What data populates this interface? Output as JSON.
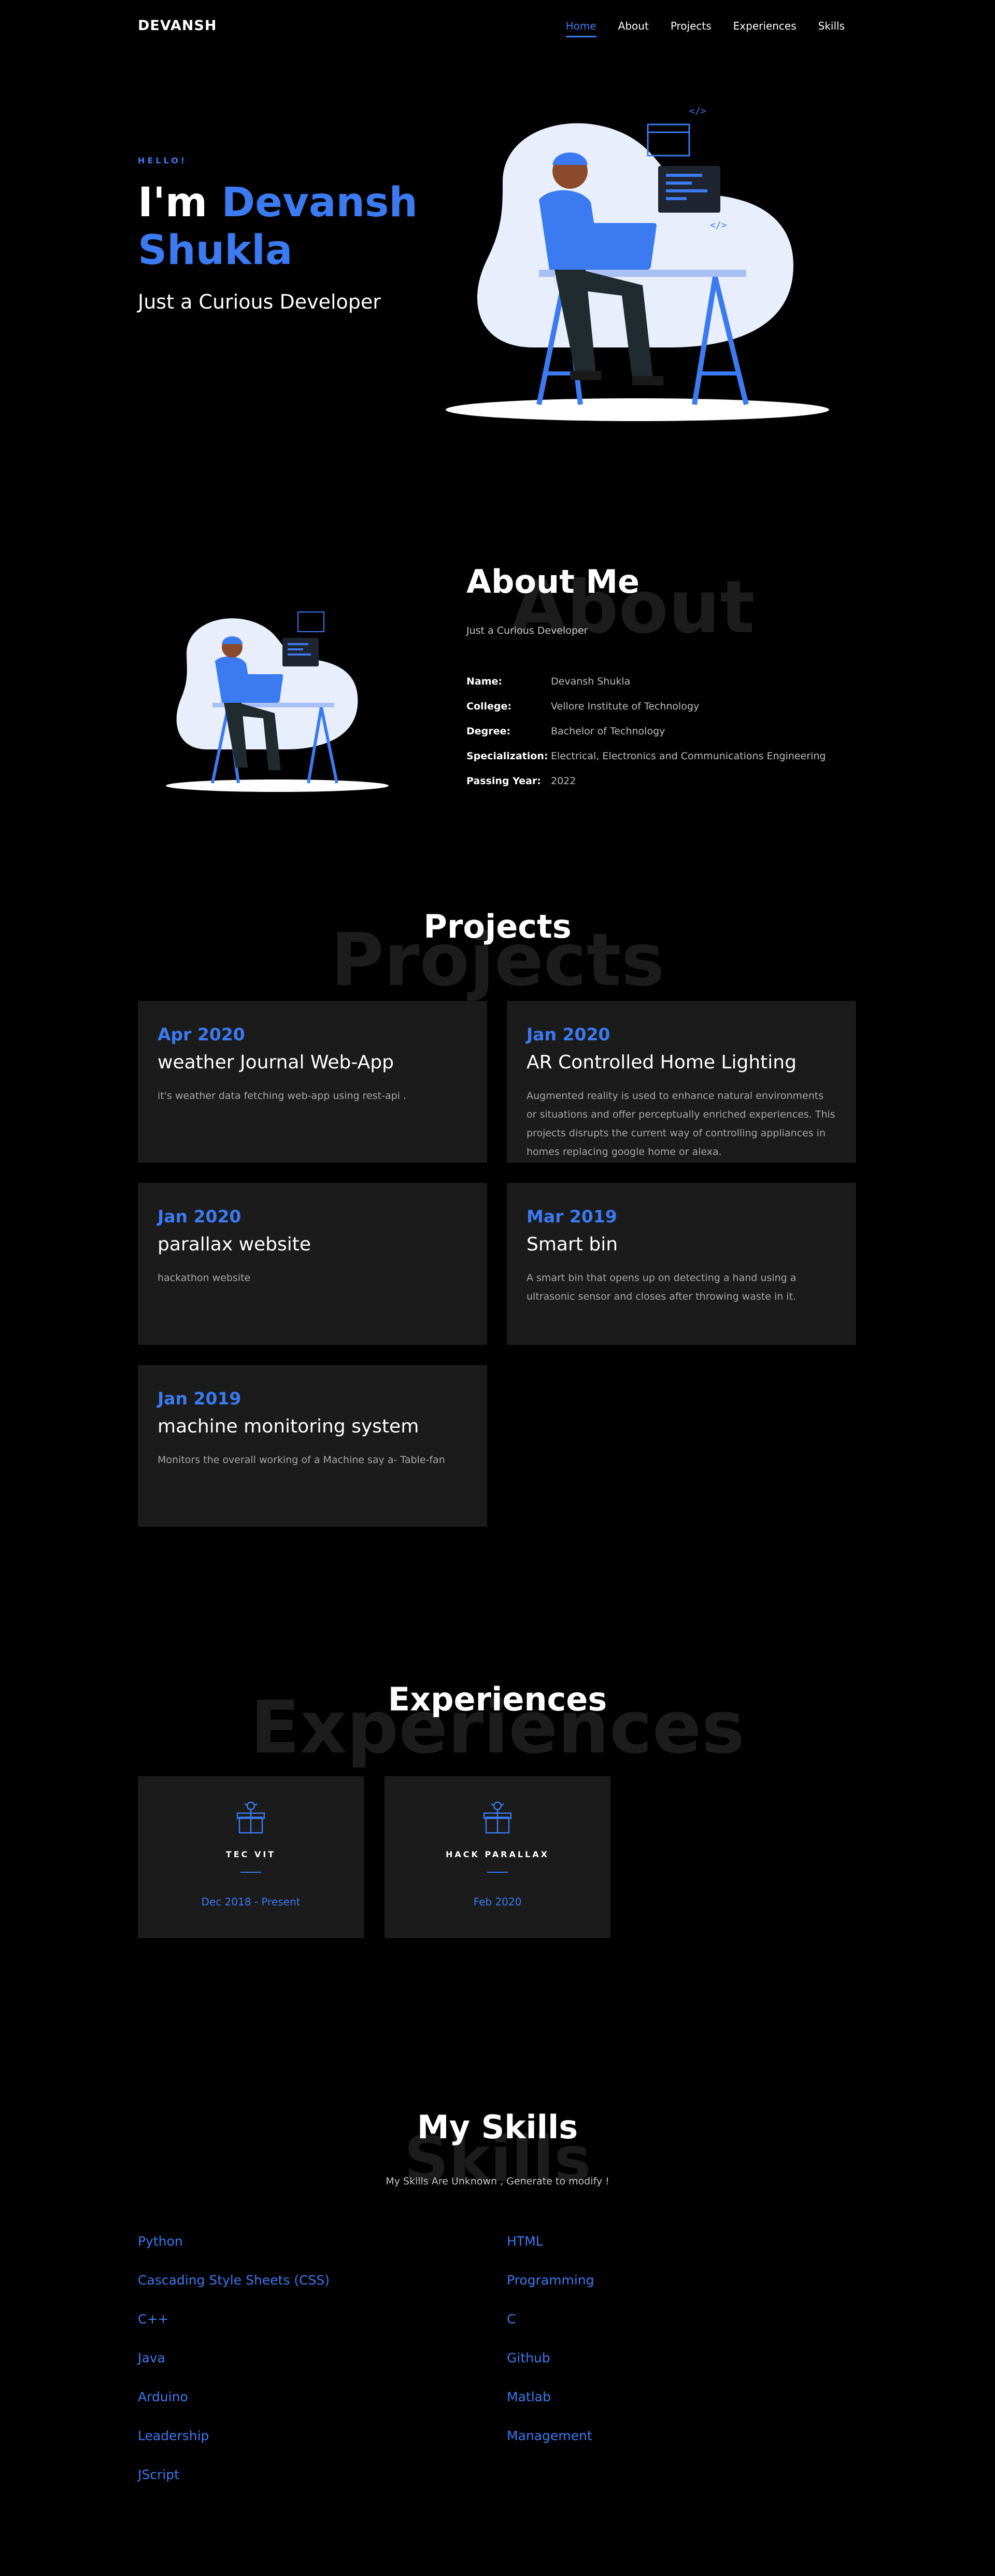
{
  "nav": {
    "logo": "DEVANSH",
    "items": [
      "Home",
      "About",
      "Projects",
      "Experiences",
      "Skills"
    ]
  },
  "hero": {
    "hello": "HELLO!",
    "im": "I'm",
    "first_name": "Devansh",
    "last_name": "Shukla",
    "tagline": "Just a Curious Developer"
  },
  "about": {
    "bg_word": "About",
    "title": "About Me",
    "subtitle": "Just a Curious Developer",
    "rows": [
      {
        "key": "Name:",
        "value": "Devansh Shukla"
      },
      {
        "key": "College:",
        "value": "Vellore Institute of Technology"
      },
      {
        "key": "Degree:",
        "value": "Bachelor of Technology"
      },
      {
        "key": "Specialization:",
        "value": "Electrical, Electronics and Communications Engineering"
      },
      {
        "key": "Passing Year:",
        "value": "2022"
      }
    ]
  },
  "projects": {
    "bg_word": "Projects",
    "title": "Projects",
    "items": [
      {
        "date": "Apr 2020",
        "name": "weather Journal Web-App",
        "desc": "it's weather data fetching web-app using rest-api ."
      },
      {
        "date": "Jan 2020",
        "name": "AR Controlled Home Lighting",
        "desc": "Augmented reality is used to enhance natural environments or situations and offer perceptually enriched experiences. This projects disrupts the current way of controlling appliances in homes replacing google home or alexa."
      },
      {
        "date": "Jan 2020",
        "name": "parallax website",
        "desc": "hackathon website"
      },
      {
        "date": "Mar 2019",
        "name": "Smart bin",
        "desc": "A smart bin that opens up on detecting a hand using a ultrasonic sensor and closes after throwing waste in it."
      },
      {
        "date": "Jan 2019",
        "name": "machine monitoring system",
        "desc": "Monitors the overall working of a Machine say a- Table-fan"
      }
    ]
  },
  "experiences": {
    "bg_word": "Experiences",
    "title": "Experiences",
    "items": [
      {
        "name": "TEC VIT",
        "date": "Dec 2018 - Present",
        "icon": "gift-box-icon"
      },
      {
        "name": "HACK PARALLAX",
        "date": "Feb 2020",
        "icon": "gift-box-icon"
      }
    ]
  },
  "skills": {
    "bg_word": "Skills",
    "title": "My Skills",
    "subtitle": "My Skills Are Unknown , Generate to modify !",
    "left": [
      "Python",
      "Cascading Style Sheets (CSS)",
      "C++",
      "Java",
      "Arduino",
      "Leadership",
      "JScript"
    ],
    "right": [
      "HTML",
      "Programming",
      "C",
      "Github",
      "Matlab",
      "Management"
    ]
  },
  "colors": {
    "accent": "#3b7af0",
    "card": "#1b1b1b",
    "background": "#000000"
  }
}
